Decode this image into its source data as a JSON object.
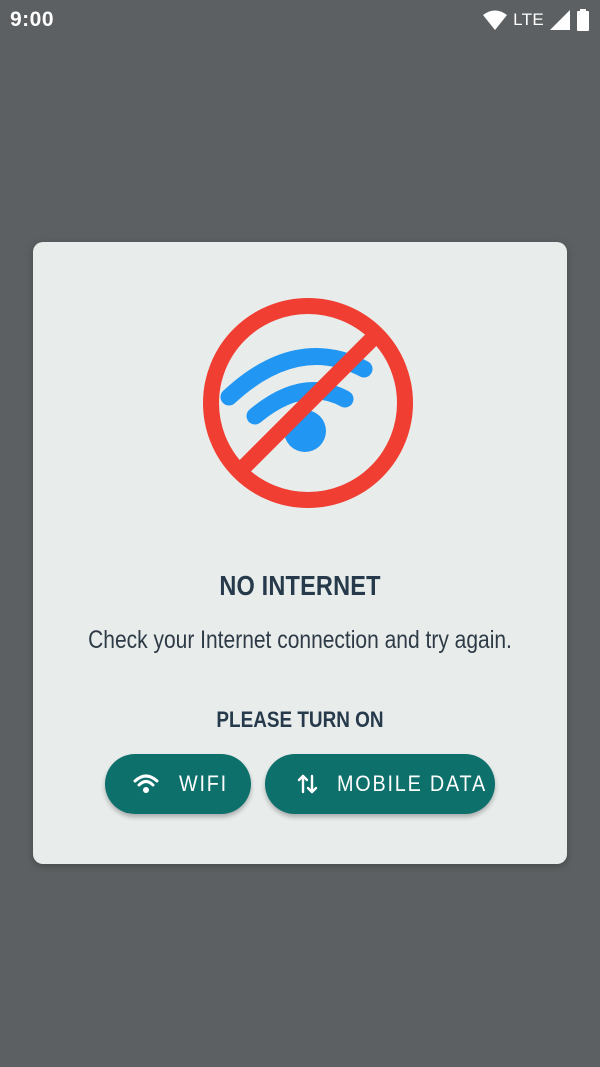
{
  "status_bar": {
    "time": "9:00",
    "network_type": "LTE",
    "icons": [
      "wifi-icon",
      "cell-signal-icon",
      "battery-icon"
    ]
  },
  "dialog": {
    "hero_icon": "no-wifi-icon",
    "title": "NO INTERNET",
    "message": "Check your Internet connection and try again.",
    "section_label": "PLEASE TURN ON",
    "buttons": [
      {
        "label": "WIFI",
        "icon": "wifi-icon"
      },
      {
        "label": "MOBILE DATA",
        "icon": "data-transfer-icon"
      }
    ]
  },
  "colors": {
    "scrim": "#5d6062",
    "dialog_background": "#e8edec",
    "button": "#0e706b",
    "title_text": "#263a4b",
    "prohibition_red": "#f03e32",
    "wifi_blue": "#2196f3"
  }
}
